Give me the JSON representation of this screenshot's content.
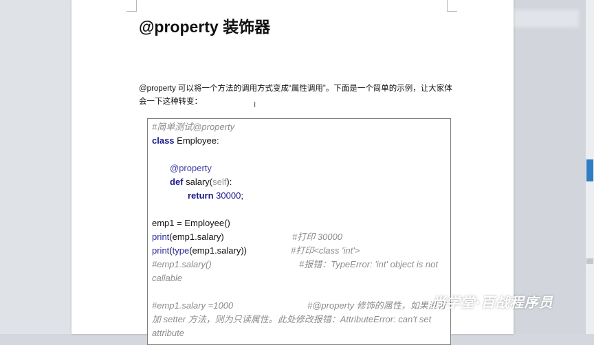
{
  "document": {
    "heading": "@property 装饰器",
    "paragraph": "@property 可以将一个方法的调用方式变成“属性调用”。下面是一个简单的示例，让大家体会一下这种转变："
  },
  "code": {
    "l01": "#简单测试@property",
    "l02_kw": "class",
    "l02_rest": " Employee:",
    "l04": "@property",
    "l05_kw": "def",
    "l05_mid": " salary(",
    "l05_self": "self",
    "l05_end": "):",
    "l06_kw": "return",
    "l06_num": " 30000",
    "l06_end": ";",
    "l08": "emp1 = Employee()",
    "l09_fn": "print",
    "l09_args": "(emp1.salary)",
    "l09_cm": "#打印 30000",
    "l10_fn": "print",
    "l10_paren": "(",
    "l10_fn2": "type",
    "l10_args": "(emp1.salary))",
    "l10_cm": "#打印<class 'int'>",
    "l11_a": "#emp1.salary()",
    "l11_b": "#报错：TypeError: 'int' object is not",
    "l12": "callable",
    "l14_a": "#emp1.salary =1000",
    "l14_b": "#@property 修饰的属性，如果没有",
    "l15": "加 setter 方法，则为只读属性。此处修改报错：AttributeError: can't set",
    "l16": "attribute"
  },
  "watermark": "尚学堂·百战程序员",
  "colors": {
    "keyword": "#1a1a8c",
    "comment": "#8c8c8c",
    "scrollbar_thumb": "#2e7cc2"
  }
}
